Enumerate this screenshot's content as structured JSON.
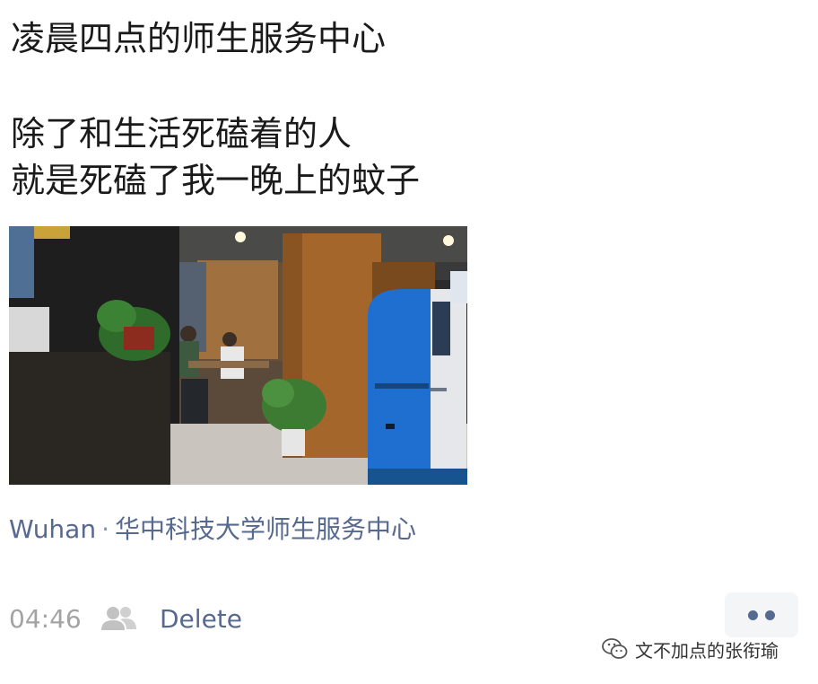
{
  "post": {
    "lines": [
      "凌晨四点的师生服务中心",
      "除了和生活死磕着的人",
      "就是死磕了我一晚上的蚊子"
    ]
  },
  "photo": {
    "icon": "photo-thumbnail",
    "description_alt": "Photo of service center interior with blue kiosks"
  },
  "location": {
    "city": "Wuhan",
    "separator": "·",
    "place": "华中科技大学师生服务中心"
  },
  "meta": {
    "time": "04:46",
    "visibility_icon": "friends-icon",
    "delete_label": "Delete",
    "more_icon": "more-dots-icon"
  },
  "watermark": {
    "text": "文不加点的张衔瑜",
    "icon": "wechat-logo-icon"
  },
  "colors": {
    "link": "#56698f",
    "muted": "#a3a3a3",
    "text": "#1a1a1a",
    "kiosk_blue": "#1f6fd0"
  }
}
